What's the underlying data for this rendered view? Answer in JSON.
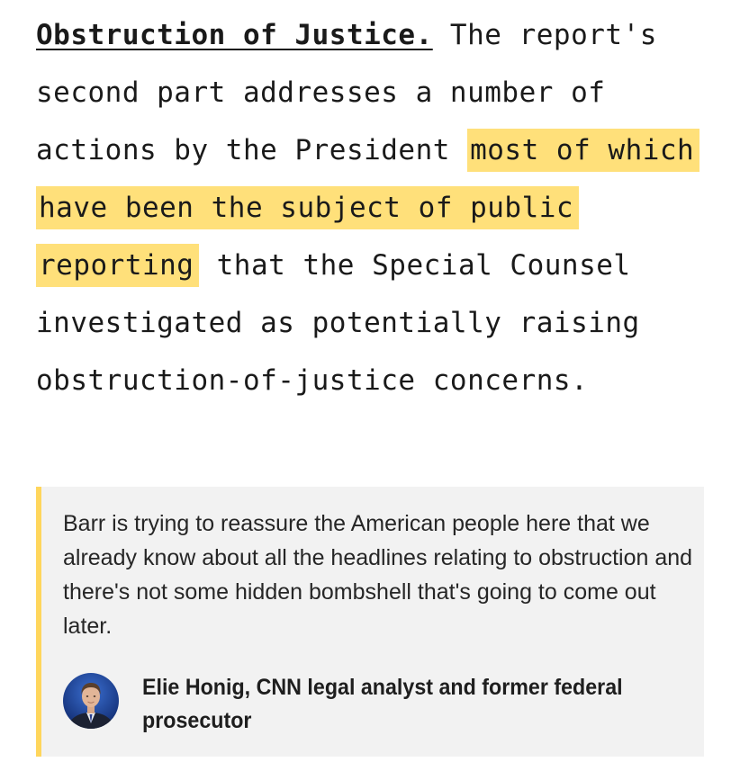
{
  "paragraph": {
    "lead": "Obstruction of Justice.",
    "text_before_highlight": " The report's second part addresses a number of actions by the President ",
    "highlight": "most of which have been the subject of public reporting",
    "text_after_highlight": " that the Special Counsel investigated as potentially raising obstruction-of-justice concerns."
  },
  "callout": {
    "quote": "Barr is trying to reassure the American people here that we already know about all the headlines relating to obstruction and there's not some hidden bombshell that's going to come out later.",
    "attribution": "Elie Honig, CNN legal analyst and former federal prosecutor",
    "accent_color": "#ffd65c",
    "background_color": "#f2f2f2"
  },
  "highlight_color": "#ffe07a"
}
